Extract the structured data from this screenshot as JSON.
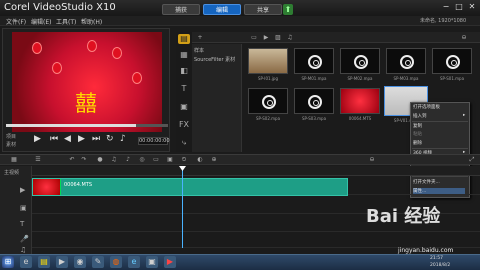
{
  "app": {
    "title": "Corel VideoStudio X10"
  },
  "tabs": [
    {
      "label": "捕获"
    },
    {
      "label": "编辑"
    },
    {
      "label": "共享"
    }
  ],
  "window": {
    "min": "−",
    "max": "□",
    "close": "✕"
  },
  "menus": [
    {
      "label": "文件(F)"
    },
    {
      "label": "编辑(E)"
    },
    {
      "label": "工具(T)"
    },
    {
      "label": "帮助(H)"
    }
  ],
  "status": {
    "project_info": "未命名, 1920*1080"
  },
  "player": {
    "timecode": "00:00:00:00",
    "labels": [
      "项目",
      "素材"
    ]
  },
  "library": {
    "tree": [
      "样本",
      "SourceFilter 素材"
    ],
    "thumbs": [
      {
        "label": "SP-I01.jpg",
        "type": "image"
      },
      {
        "label": "SP-M01.mpa",
        "type": "audio"
      },
      {
        "label": "SP-M02.mpa",
        "type": "audio"
      },
      {
        "label": "SP-M03.mpa",
        "type": "audio"
      },
      {
        "label": "SP-S01.mpa",
        "type": "audio"
      },
      {
        "label": "SP-S02.mpa",
        "type": "audio"
      },
      {
        "label": "SP-S03.mpa",
        "type": "audio"
      },
      {
        "label": "00064.MTS",
        "type": "video"
      },
      {
        "label": "SP-V01.mp4",
        "type": "video"
      }
    ]
  },
  "context_menu": {
    "items": [
      {
        "label": "打开选项面板",
        "disabled": false
      },
      {
        "label": "插入到",
        "disabled": false,
        "submenu": true
      },
      {
        "label": "复制",
        "disabled": false
      },
      {
        "label": "粘贴",
        "disabled": true
      },
      {
        "label": "删除",
        "disabled": false
      },
      {
        "label": "360 视频",
        "disabled": false,
        "submenu": true
      },
      {
        "label": "按场景分割...",
        "disabled": true
      },
      {
        "label": "多重修整视频",
        "disabled": true
      },
      {
        "label": "打开文件夹...",
        "disabled": false
      },
      {
        "label": "属性...",
        "disabled": false
      }
    ]
  },
  "timeline": {
    "clip_label": "00064.MTS",
    "track_label": "主视频"
  },
  "watermark": {
    "brand": "Bai 经验",
    "url": "jingyan.baidu.com"
  },
  "taskbar": {
    "time": "21:57",
    "date": "2018/8/2"
  }
}
